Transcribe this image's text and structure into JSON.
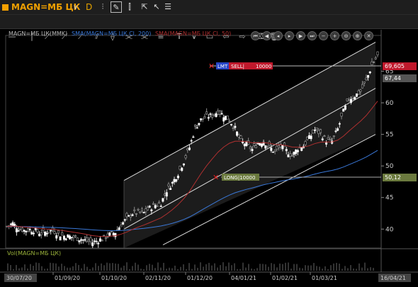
{
  "toolbar": {
    "symbol": "MAGN=МБ ЦК",
    "timeframe": "D",
    "icons": [
      "candles-icon",
      "draw-pen-icon",
      "bars-icon",
      "cursor-icon",
      "pointer-icon",
      "list-icon"
    ]
  },
  "drawing_tools": [
    "line-tool",
    "vertical-line-tool",
    "segment-tool",
    "ray-tool",
    "ray-2-tool",
    "parallel-channel-tool",
    "fan-tool",
    "fib-tool",
    "fib-2-tool",
    "horizontal-channel-tool",
    "text-tool",
    "pitchfork-tool",
    "rect-tool",
    "arrow-left-tool",
    "arrow-right-tool",
    "eraser-tool",
    "trash-tool"
  ],
  "legend": {
    "price_label": "MAGN=МБ ЦК(MMK)",
    "sma200_label": "SMA(MAGN=МБ ЦК.Cl, 200)",
    "sma50_label": "SMA(MAGN=МБ ЦК.Cl, 50)",
    "volume_label": "Vol(MAGN=МБ ЦК)"
  },
  "colors": {
    "sma200": "#3a78d8",
    "sma50": "#b03030",
    "up": "#ffffff",
    "down": "#808080",
    "accent": "#f0a000",
    "sell": "#c0192c",
    "long": "#6b7a3e"
  },
  "orders": {
    "sell": {
      "type": "LMT",
      "side": "SELL",
      "qty": "10000",
      "price_label": "69,605"
    },
    "long": {
      "side": "LONG",
      "qty": "10000",
      "price_label": "50,12"
    }
  },
  "last_price_label": "67,44",
  "chart_data": {
    "type": "candlestick",
    "y_ticks": [
      40,
      45,
      50,
      55,
      60,
      65
    ],
    "y_tick_labels": [
      "40",
      "45",
      "50",
      "55",
      "60",
      "65"
    ],
    "ylim": [
      37,
      70
    ],
    "x_labels": [
      "30/07/20",
      "01/09/20",
      "01/10/20",
      "02/11/20",
      "01/12/20",
      "04/01/21",
      "01/02/21",
      "01/03/21",
      "16/04/21"
    ],
    "first_date": "30/07/20",
    "last_date": "16/04/21",
    "close_path": [
      40.4,
      40.9,
      40.1,
      39.8,
      39.9,
      39.7,
      39.3,
      39.6,
      39.8,
      39.2,
      38.9,
      38.8,
      38.6,
      38.4,
      38.1,
      37.9,
      38.2,
      38.6,
      39.1,
      39.5,
      40.7,
      41.6,
      42.5,
      42.6,
      42.6,
      43.3,
      43.8,
      44.1,
      46.1,
      47.3,
      48.8,
      50.7,
      52.9,
      56.0,
      57.3,
      57.8,
      58.0,
      58.6,
      58.0,
      57.3,
      55.9,
      53.9,
      53.4,
      52.6,
      53.6,
      53.9,
      53.0,
      52.2,
      53.1,
      52.4,
      51.6,
      52.8,
      53.2,
      54.4,
      55.7,
      55.1,
      54.0,
      53.9,
      55.8,
      58.6,
      60.6,
      61.1,
      61.8,
      63.5,
      66.0,
      67.44
    ],
    "channel_lines": [
      {
        "name": "upper",
        "start": {
          "date": "01/10/20",
          "value": 47.7
        },
        "end": {
          "date": "16/04/21",
          "value": 69.6
        }
      },
      {
        "name": "middle",
        "start": {
          "date": "01/10/20",
          "value": 40.0
        },
        "end": {
          "date": "16/04/21",
          "value": 62.3
        }
      },
      {
        "name": "lower",
        "start": {
          "date": "02/11/20",
          "value": 37.5
        },
        "end": {
          "date": "16/04/21",
          "value": 55.0
        }
      }
    ]
  }
}
